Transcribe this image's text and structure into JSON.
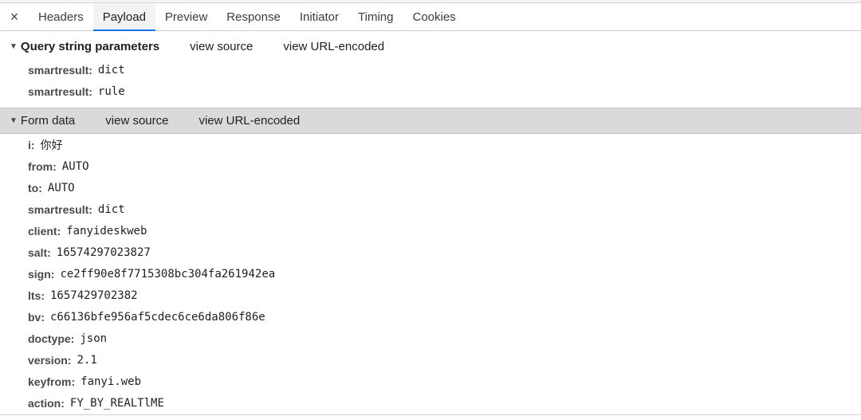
{
  "tabs": [
    {
      "label": "Headers"
    },
    {
      "label": "Payload"
    },
    {
      "label": "Preview"
    },
    {
      "label": "Response"
    },
    {
      "label": "Initiator"
    },
    {
      "label": "Timing"
    },
    {
      "label": "Cookies"
    }
  ],
  "active_tab": "Payload",
  "close_icon": "×",
  "query_section": {
    "toggle_icon": "▼",
    "title": "Query string parameters",
    "view_source": "view source",
    "view_url_encoded": "view URL-encoded",
    "params": [
      {
        "key": "smartresult:",
        "value": "dict"
      },
      {
        "key": "smartresult:",
        "value": "rule"
      }
    ]
  },
  "form_section": {
    "toggle_icon": "▼",
    "title": "Form data",
    "view_source": "view source",
    "view_url_encoded": "view URL-encoded",
    "params": [
      {
        "key": "i:",
        "value": "你好"
      },
      {
        "key": "from:",
        "value": "AUTO"
      },
      {
        "key": "to:",
        "value": "AUTO"
      },
      {
        "key": "smartresult:",
        "value": "dict"
      },
      {
        "key": "client:",
        "value": "fanyideskweb"
      },
      {
        "key": "salt:",
        "value": "16574297023827"
      },
      {
        "key": "sign:",
        "value": "ce2ff90e8f7715308bc304fa261942ea"
      },
      {
        "key": "lts:",
        "value": "1657429702382"
      },
      {
        "key": "bv:",
        "value": "c66136bfe956af5cdec6ce6da806f86e"
      },
      {
        "key": "doctype:",
        "value": "json"
      },
      {
        "key": "version:",
        "value": "2.1"
      },
      {
        "key": "keyfrom:",
        "value": "fanyi.web"
      },
      {
        "key": "action:",
        "value": "FY_BY_REALTlME"
      }
    ]
  }
}
